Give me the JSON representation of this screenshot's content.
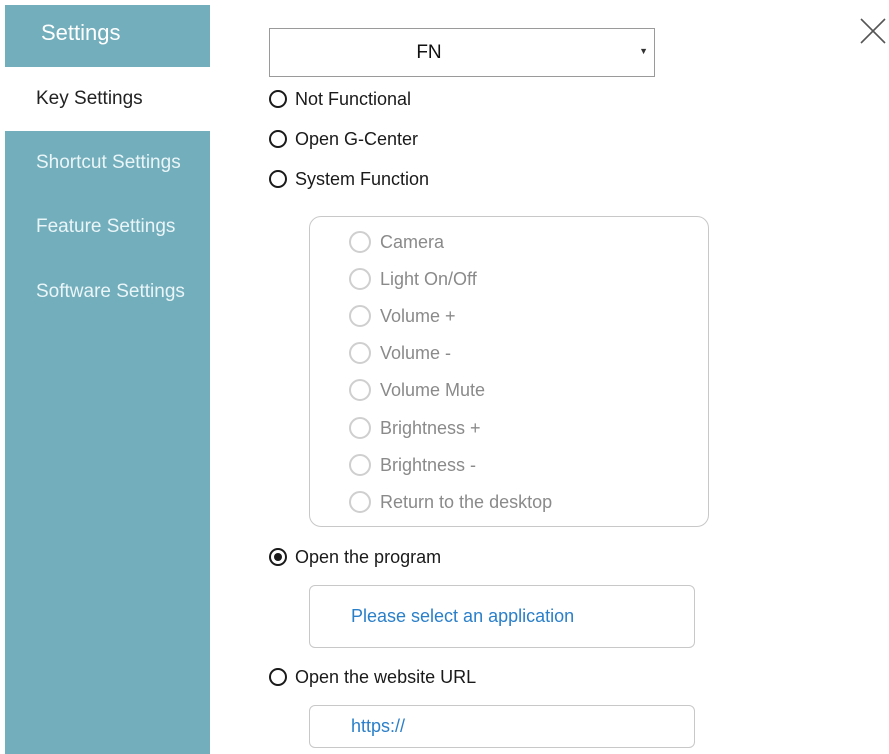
{
  "sidebar": {
    "title": "Settings",
    "items": [
      {
        "label": "Key Settings",
        "active": true
      },
      {
        "label": "Shortcut Settings",
        "active": false
      },
      {
        "label": "Feature Settings",
        "active": false
      },
      {
        "label": "Software Settings",
        "active": false
      }
    ]
  },
  "colors": {
    "sidebar_bg": "#72aebb",
    "link_blue": "#2a7fc9"
  },
  "dropdown": {
    "selected": "FN",
    "arrow_icon": "triangle-down-icon"
  },
  "close_icon": "close-icon",
  "options": {
    "not_functional": {
      "label": "Not Functional",
      "checked": false
    },
    "open_g_center": {
      "label": "Open G-Center",
      "checked": false
    },
    "system_function": {
      "label": "System Function",
      "checked": false
    },
    "open_program": {
      "label": "Open the program",
      "checked": true
    },
    "open_website": {
      "label": "Open the website URL",
      "checked": false
    }
  },
  "system_functions": [
    "Camera",
    "Light On/Off",
    "Volume +",
    "Volume -",
    "Volume Mute",
    "Brightness +",
    "Brightness -",
    "Return to the desktop"
  ],
  "program_field": {
    "placeholder": "Please select an application"
  },
  "url_field": {
    "value": "https://"
  }
}
